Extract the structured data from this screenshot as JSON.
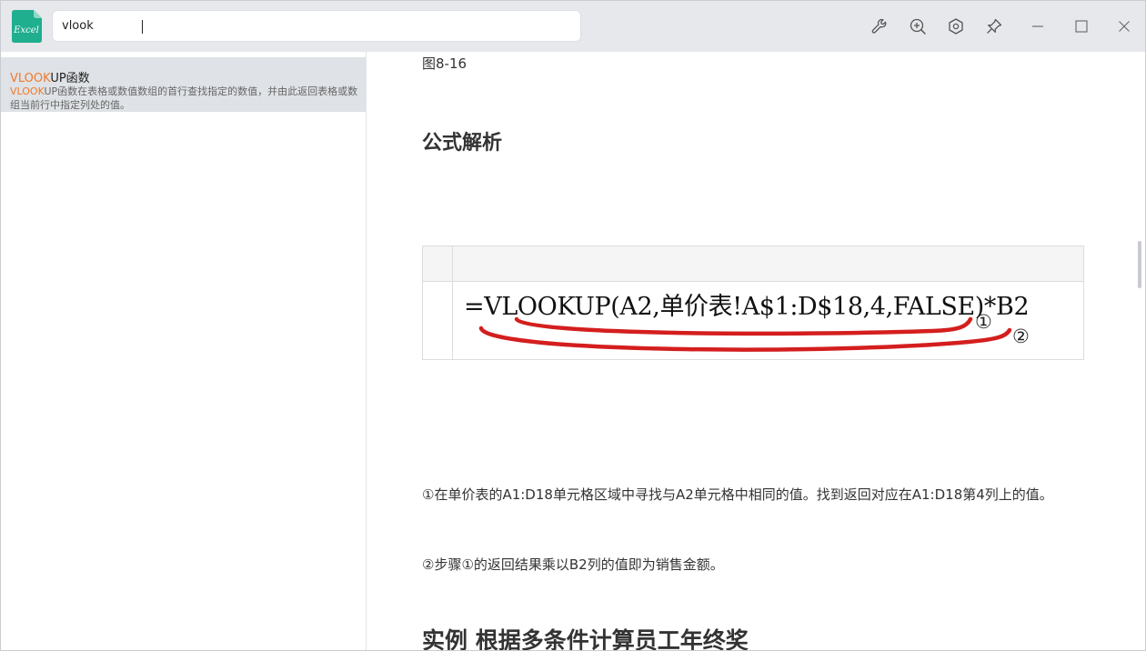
{
  "app": {
    "icon_text": "Excel",
    "accent": "#1fae8e"
  },
  "search": {
    "value": "vlook",
    "placeholder": ""
  },
  "toolbar": {
    "buttons": [
      "wrench-icon",
      "zoom-in-icon",
      "settings-icon",
      "pin-icon",
      "minimize-icon",
      "maximize-icon",
      "close-icon"
    ]
  },
  "results": [
    {
      "title_highlight": "VLOOK",
      "title_rest": "UP函数",
      "desc_highlight": "VLOOK",
      "desc_rest": "UP函数在表格或数值数组的首行查找指定的数值，并由此返回表格或数组当前行中指定列处的值。"
    }
  ],
  "article": {
    "fig_caption": "图8-16",
    "section_heading": "公式解析",
    "formula": "=VLOOKUP(A2,单价表!A$1:D$18,4,FALSE)*B2",
    "marker_1": "①",
    "marker_2": "②",
    "para_1": "①在单价表的A1:D18单元格区域中寻找与A2单元格中相同的值。找到返回对应在A1:D18第4列上的值。",
    "para_2": "②步骤①的返回结果乘以B2列的值即为销售金额。",
    "next_heading": "实例 根据多条件计算员工年终奖"
  },
  "colors": {
    "highlight": "#f07a2a",
    "selected_item_bg": "#dfe2e6",
    "titlebar_bg": "#e6e8eb",
    "annotation_red": "#d41e1e"
  }
}
